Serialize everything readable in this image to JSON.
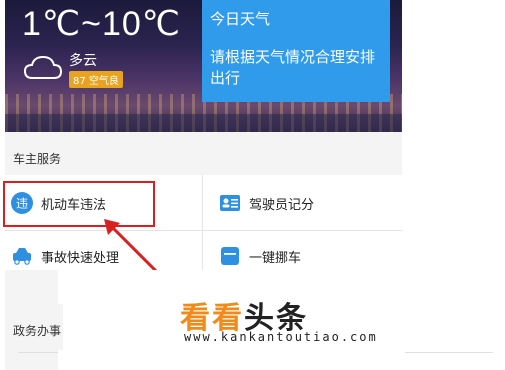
{
  "weather": {
    "temperature": "1℃~10℃",
    "condition": "多云",
    "aqi": "87 空气良",
    "icon": "cloud-icon"
  },
  "weather_card": {
    "title": "今日天气",
    "text": "请根据天气情况合理安排出行"
  },
  "owner_services": {
    "title": "车主服务",
    "items": [
      {
        "label": "机动车违法",
        "icon": "violation-icon",
        "color": "#2f8fe0"
      },
      {
        "label": "驾驶员记分",
        "icon": "driver-card-icon",
        "color": "#2f8fe0"
      },
      {
        "label": "事故快速处理",
        "icon": "car-accident-icon",
        "color": "#2f8fe0"
      },
      {
        "label": "一键挪车",
        "icon": "move-car-icon",
        "color": "#2f8fe0"
      }
    ]
  },
  "gov_services": {
    "title": "政务办事"
  },
  "watermark": {
    "brand_kan": "看看",
    "brand_tt": "头条",
    "url": "www.kankantoutiao.com"
  },
  "colors": {
    "accent": "#2f9bea",
    "highlight": "#d92020",
    "aqi_badge": "#e8a420",
    "brand_orange": "#f08a1a"
  }
}
